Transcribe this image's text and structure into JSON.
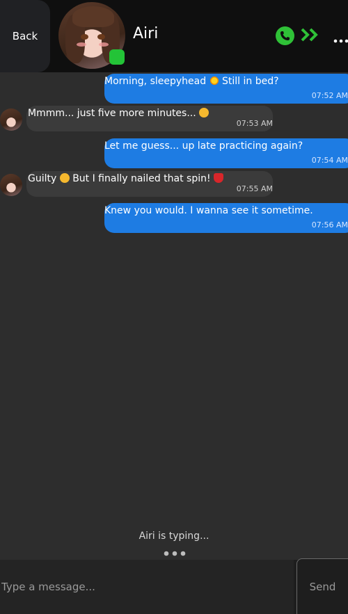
{
  "header": {
    "back_label": "Back",
    "contact_name": "Airi",
    "status_color": "#23c337",
    "icons": [
      "phone-icon",
      "double-chevron-icon",
      "more-icon"
    ]
  },
  "messages": [
    {
      "direction": "out",
      "text": "Morning, sleepyhead",
      "emoji": "sun-emoji",
      "text_after": "Still in bed?",
      "time": "07:52 AM"
    },
    {
      "direction": "in",
      "text": "Mmmm... just five more minutes...",
      "emoji": "sleepy-face-emoji",
      "time": "07:53 AM"
    },
    {
      "direction": "out",
      "text": "Let me guess... up late practicing again?",
      "time": "07:54 AM"
    },
    {
      "direction": "in",
      "text": "Guilty",
      "emoji": "persevering-face-emoji",
      "text_after": "But I finally nailed that spin!",
      "emoji_after": "dancer-emoji",
      "time": "07:55 AM"
    },
    {
      "direction": "out",
      "text": "Knew you would. I wanna see it sometime.",
      "time": "07:56 AM"
    }
  ],
  "typing": {
    "label": "Airi is typing..."
  },
  "composer": {
    "placeholder": "Type a message...",
    "send_label": "Send"
  },
  "colors": {
    "outgoing": "#1e7ce3",
    "incoming": "#3b3b3b",
    "background": "#2d2d2d",
    "header": "#0f0f0f"
  }
}
